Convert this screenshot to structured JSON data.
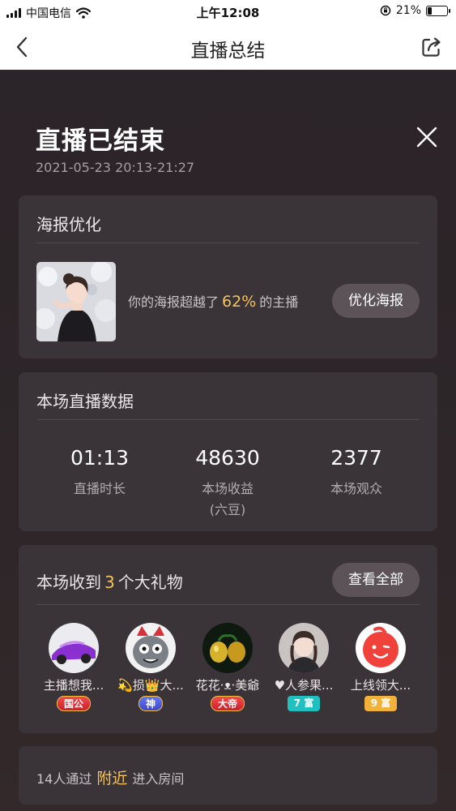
{
  "status_bar": {
    "carrier": "中国电信",
    "time": "上午12:08",
    "battery_percent": "21%",
    "battery_level": 0.21
  },
  "nav": {
    "title": "直播总结",
    "back_icon": "chevron-left-icon",
    "share_icon": "share-icon"
  },
  "summary": {
    "title": "直播已结束",
    "time_range": "2021-05-23 20:13-21:27"
  },
  "poster": {
    "heading": "海报优化",
    "text_before": "你的海报超越了",
    "percent": "62%",
    "text_after": "的主播",
    "button": "优化海报"
  },
  "stats": {
    "heading": "本场直播数据",
    "items": [
      {
        "value": "01:13",
        "label": "直播时长",
        "sub": ""
      },
      {
        "value": "48630",
        "label": "本场收益",
        "sub": "(六豆)"
      },
      {
        "value": "2377",
        "label": "本场观众",
        "sub": ""
      }
    ]
  },
  "gifts": {
    "heading_before": "本场收到",
    "count": "3",
    "heading_after": "个大礼物",
    "button": "查看全部",
    "donors": [
      {
        "name": "主播想我...",
        "badge": "国公"
      },
      {
        "name": "💫损👑大...",
        "badge": "神"
      },
      {
        "name": "花花·ᴥ·美爺",
        "badge": "大帝"
      },
      {
        "name": "♥人参果...",
        "badge": "7 富"
      },
      {
        "name": "上线领大...",
        "badge": "9 富"
      }
    ]
  },
  "entry": {
    "text_before": "14人通过",
    "source": "附近",
    "text_after": "进入房间"
  },
  "colors": {
    "accent": "#f5c35a",
    "card": "#3a3337",
    "background": "#2b2428"
  }
}
